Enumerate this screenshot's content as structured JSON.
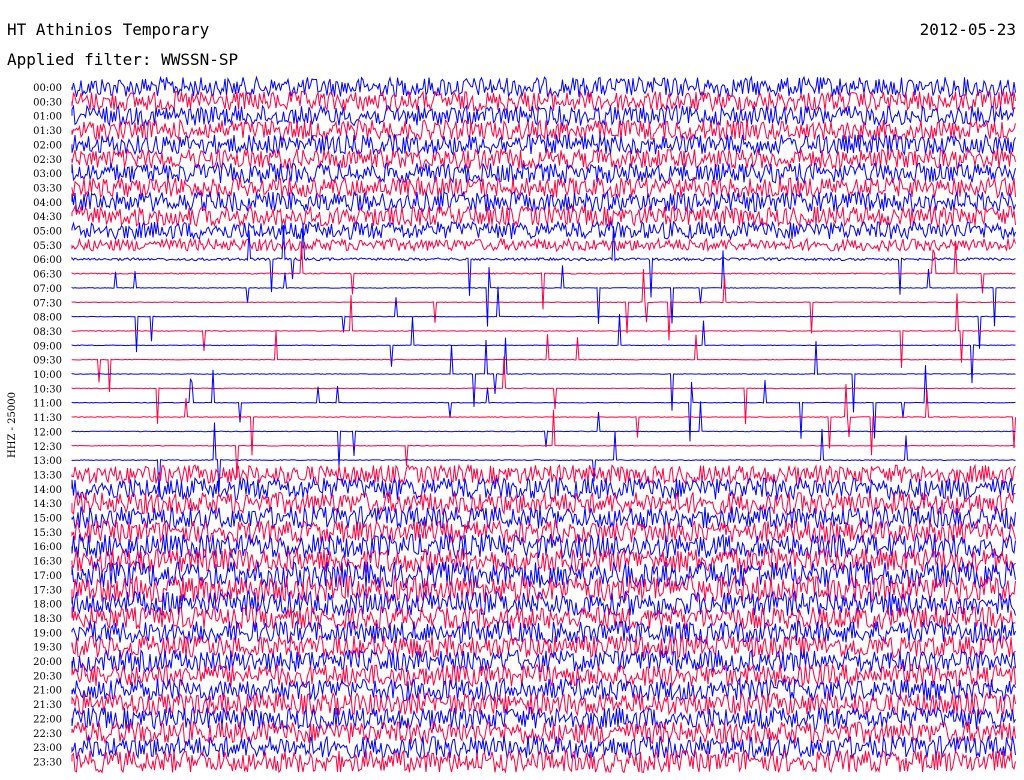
{
  "header": {
    "station": "HT Athinios Temporary",
    "date": "2012-05-23",
    "filter": "Applied filter: WWSSN-SP"
  },
  "chart_data": {
    "type": "line",
    "title": "HT Athinios Temporary",
    "ylabel": "HHZ - 25000",
    "time_labels": [
      "00:00",
      "00:30",
      "01:00",
      "01:30",
      "02:00",
      "02:30",
      "03:00",
      "03:30",
      "04:00",
      "04:30",
      "05:00",
      "05:30",
      "06:00",
      "06:30",
      "07:00",
      "07:30",
      "08:00",
      "08:30",
      "09:00",
      "09:30",
      "10:00",
      "10:30",
      "11:00",
      "11:30",
      "12:00",
      "12:30",
      "13:00",
      "13:30",
      "14:00",
      "14:30",
      "15:00",
      "15:30",
      "16:00",
      "16:30",
      "17:00",
      "17:30",
      "18:00",
      "18:30",
      "19:00",
      "19:30",
      "20:00",
      "20:30",
      "21:00",
      "21:30",
      "22:00",
      "22:30",
      "23:00",
      "23:30"
    ],
    "series_colors": [
      "#0000ff",
      "#ff0040"
    ],
    "relative_noise_level": [
      0.9,
      0.9,
      0.9,
      0.9,
      0.9,
      0.9,
      0.9,
      0.9,
      0.9,
      0.9,
      0.8,
      0.55,
      0.12,
      0.05,
      0.03,
      0.03,
      0.03,
      0.03,
      0.03,
      0.03,
      0.03,
      0.03,
      0.03,
      0.03,
      0.03,
      0.03,
      0.04,
      0.85,
      1.0,
      1.0,
      1.0,
      1.0,
      1.1,
      1.1,
      1.2,
      1.2,
      1.1,
      1.0,
      1.0,
      1.0,
      1.0,
      1.0,
      1.0,
      1.0,
      1.0,
      1.0,
      1.0,
      1.0
    ]
  }
}
